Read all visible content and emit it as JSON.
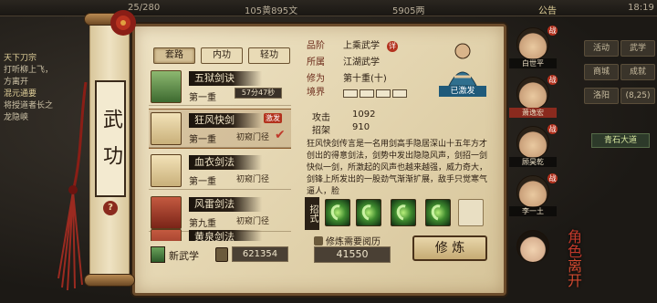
{
  "topbar": {
    "left_value": "25/280",
    "gold": "105黄895文",
    "silver": "5905两",
    "notice": "公告",
    "time": "18:19"
  },
  "quest": {
    "title": "天下刀宗",
    "line1": "打听柳上飞，",
    "line2": "方离开",
    "title2": "混元通要",
    "line3": "将授道者长之",
    "line4": "龙隐峡"
  },
  "right_menu": {
    "b1": "活动",
    "b2": "武学",
    "b3": "商城",
    "b4": "成就",
    "b5": "洛阳",
    "b6": "(8,25)"
  },
  "location": "青石大道",
  "scroll_title": "武功",
  "tabs": [
    "套路",
    "内功",
    "轻功"
  ],
  "skills": [
    {
      "name": "五狱剑诀",
      "level": "第一重",
      "timer": "57分47秒"
    },
    {
      "name": "狂风快剑",
      "level": "第一重",
      "status": "初窥门径",
      "tag": "激发",
      "check": "✔"
    },
    {
      "name": "血衣剑法",
      "level": "第一重",
      "status": "初窥门径"
    },
    {
      "name": "风雷剑法",
      "level": "第九重",
      "status": "初窥门径"
    },
    {
      "name": "黄泉剑法",
      "level": "",
      "status": ""
    }
  ],
  "new_skill": "新武学",
  "book_count": "621354",
  "detail": {
    "rank_k": "品阶",
    "rank_v": "上乘武学",
    "rank_badge": "详",
    "faction_k": "所属",
    "faction_v": "江湖武学",
    "cult_k": "修为",
    "cult_v": "第十重(十)",
    "realm_k": "境界",
    "status_label": "已激发",
    "attack_k": "攻击",
    "attack_v": "1092",
    "parry_k": "招架",
    "parry_v": "910",
    "description": "狂风快剑传言是一名用剑高手隐居深山十五年方才创出的得意剑法，剑势中发出隐隐风声，剑招一剑快似一剑，所激起的风声也越来越强，威力奇大，剑锋上所发出的一股劲气渐渐扩展，敌手只觉寒气逼人，脸"
  },
  "moves_label": "招式",
  "req_label": "修炼需要阅历",
  "req_value": "41550",
  "cultivate": "修 炼",
  "chars": [
    {
      "name": "白世平",
      "mark": "战"
    },
    {
      "name": "萧逸宏",
      "mark": "战"
    },
    {
      "name": "顾昊乾",
      "mark": "战"
    },
    {
      "name": "李一土",
      "mark": "战"
    },
    {
      "name": "",
      "mark": ""
    }
  ],
  "role_btn": "角色",
  "leave_btn": "离开",
  "colors": {
    "parchment": "#e2d3ad",
    "frame": "#6b4b2b",
    "accent_red": "#b3321e"
  }
}
